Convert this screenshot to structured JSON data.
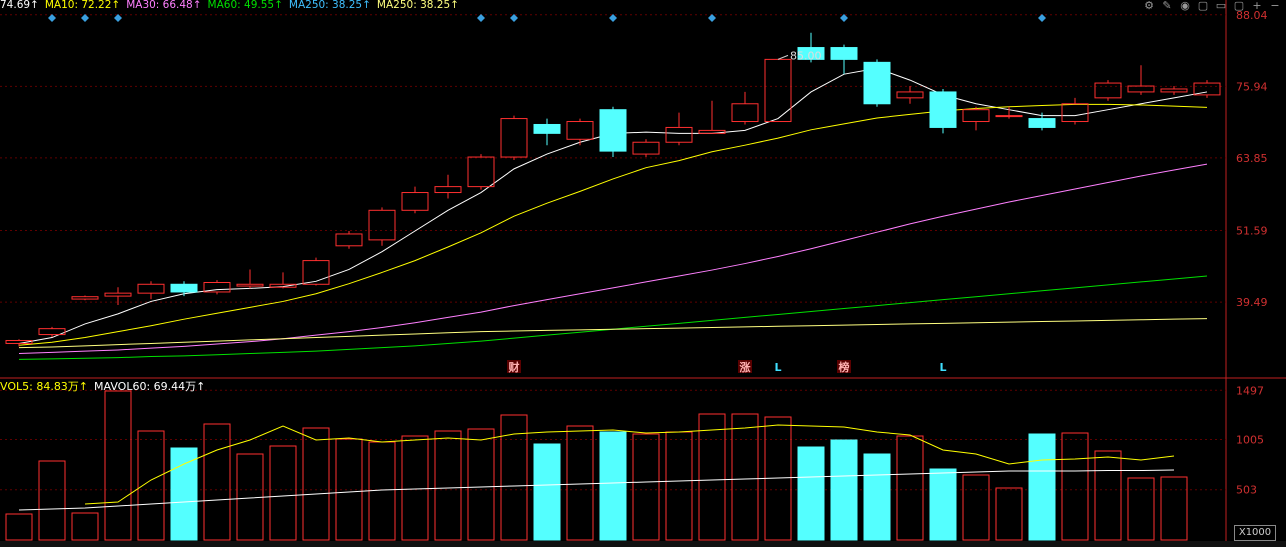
{
  "header": {
    "ma5": {
      "label": "74.69",
      "color": "#ffffff"
    },
    "ma10": {
      "label": "MA10: 72.22",
      "color": "#ffff00"
    },
    "ma30": {
      "label": "MA30: 66.48",
      "color": "#ff80ff"
    },
    "ma60": {
      "label": "MA60: 49.55",
      "color": "#00e000"
    },
    "ma250a": {
      "label": "MA250: 38.25",
      "color": "#40c0ff"
    },
    "ma250b": {
      "label": "MA250: 38.25",
      "color": "#ffff80"
    },
    "arrow": "↑"
  },
  "volume_header": {
    "mavol5": {
      "label": "VOL5: 84.83万",
      "color": "#ffff00"
    },
    "mavol60": {
      "label": "MAVOL60: 69.44万",
      "color": "#ffffff"
    },
    "arrow": "↑"
  },
  "tools": [
    "⚙",
    "✎",
    "◉",
    "▢",
    "▭",
    "▢",
    "+",
    "−"
  ],
  "volume_unit": "X1000",
  "colors": {
    "background": "#000000",
    "up": "#ff3030",
    "down": "#54ffff",
    "grid": "#600000",
    "axis": "#c02020",
    "axis_text": "#d03030"
  },
  "chart_data": [
    {
      "type": "candlestick",
      "y_ticks": [
        "88.04",
        "75.94",
        "63.85",
        "51.59",
        "39.49"
      ],
      "y_tick_values": [
        88.04,
        75.94,
        63.85,
        51.59,
        39.49
      ],
      "ylim": [
        27.0,
        88.0
      ],
      "grid": true,
      "annotation_high": {
        "label": "85.00",
        "index": 23
      },
      "candles": [
        {
          "o": 32.5,
          "c": 33.0,
          "h": 33.2,
          "l": 32.0
        },
        {
          "o": 34.0,
          "c": 35.0,
          "h": 35.3,
          "l": 33.6
        },
        {
          "o": 40.0,
          "c": 40.4,
          "h": 40.6,
          "l": 39.8
        },
        {
          "o": 40.5,
          "c": 41.0,
          "h": 42.0,
          "l": 39.0
        },
        {
          "o": 41.0,
          "c": 42.5,
          "h": 43.0,
          "l": 40.0
        },
        {
          "o": 42.5,
          "c": 41.2,
          "h": 43.0,
          "l": 40.5
        },
        {
          "o": 41.2,
          "c": 42.8,
          "h": 43.2,
          "l": 40.8
        },
        {
          "o": 42.2,
          "c": 42.5,
          "h": 45.0,
          "l": 41.8
        },
        {
          "o": 42.0,
          "c": 42.5,
          "h": 44.5,
          "l": 41.8
        },
        {
          "o": 42.5,
          "c": 46.5,
          "h": 47.0,
          "l": 42.3
        },
        {
          "o": 49.0,
          "c": 51.0,
          "h": 51.5,
          "l": 48.5
        },
        {
          "o": 50.0,
          "c": 55.0,
          "h": 55.5,
          "l": 49.0
        },
        {
          "o": 55.0,
          "c": 58.0,
          "h": 59.0,
          "l": 54.5
        },
        {
          "o": 58.0,
          "c": 59.0,
          "h": 61.0,
          "l": 57.0
        },
        {
          "o": 59.0,
          "c": 64.0,
          "h": 64.5,
          "l": 58.5
        },
        {
          "o": 64.0,
          "c": 70.5,
          "h": 71.0,
          "l": 63.5
        },
        {
          "o": 69.5,
          "c": 68.0,
          "h": 70.5,
          "l": 66.0
        },
        {
          "o": 67.0,
          "c": 70.0,
          "h": 70.5,
          "l": 66.0
        },
        {
          "o": 72.0,
          "c": 65.0,
          "h": 72.5,
          "l": 64.0
        },
        {
          "o": 64.5,
          "c": 66.5,
          "h": 67.0,
          "l": 64.0
        },
        {
          "o": 66.5,
          "c": 69.0,
          "h": 71.5,
          "l": 66.0
        },
        {
          "o": 68.0,
          "c": 68.5,
          "h": 73.5,
          "l": 68.0
        },
        {
          "o": 70.0,
          "c": 73.0,
          "h": 75.0,
          "l": 69.5
        },
        {
          "o": 70.0,
          "c": 80.5,
          "h": 80.5,
          "l": 70.0
        },
        {
          "o": 82.5,
          "c": 80.5,
          "h": 85.0,
          "l": 80.0
        },
        {
          "o": 82.5,
          "c": 80.5,
          "h": 83.0,
          "l": 78.0
        },
        {
          "o": 80.0,
          "c": 73.0,
          "h": 80.5,
          "l": 72.5
        },
        {
          "o": 74.0,
          "c": 75.0,
          "h": 76.0,
          "l": 73.0
        },
        {
          "o": 75.0,
          "c": 69.0,
          "h": 75.5,
          "l": 68.0
        },
        {
          "o": 70.0,
          "c": 72.0,
          "h": 72.5,
          "l": 68.5
        },
        {
          "o": 71.0,
          "c": 71.0,
          "h": 72.5,
          "l": 70.5
        },
        {
          "o": 70.5,
          "c": 69.0,
          "h": 71.5,
          "l": 68.5
        },
        {
          "o": 70.0,
          "c": 73.0,
          "h": 74.0,
          "l": 69.5
        },
        {
          "o": 74.0,
          "c": 76.5,
          "h": 77.0,
          "l": 73.5
        },
        {
          "o": 75.0,
          "c": 76.0,
          "h": 79.5,
          "l": 74.5
        },
        {
          "o": 75.0,
          "c": 75.5,
          "h": 76.0,
          "l": 74.5
        },
        {
          "o": 74.5,
          "c": 76.5,
          "h": 77.0,
          "l": 74.0
        }
      ],
      "series": [
        {
          "color_key": "ma5",
          "values": [
            32.5,
            33.5,
            35.8,
            37.5,
            39.6,
            40.9,
            41.6,
            41.8,
            42.1,
            43.0,
            45.0,
            48.0,
            51.5,
            55.0,
            58.0,
            62.0,
            64.5,
            66.5,
            68.0,
            68.2,
            68.0,
            68.0,
            68.5,
            70.5,
            75.0,
            78.0,
            79.0,
            77.0,
            74.5,
            73.0,
            72.0,
            71.0,
            71.0,
            72.0,
            73.0,
            74.0,
            75.0
          ]
        },
        {
          "color_key": "ma10",
          "values": [
            32.2,
            32.7,
            33.5,
            34.5,
            35.5,
            36.6,
            37.6,
            38.6,
            39.6,
            40.9,
            42.6,
            44.5,
            46.5,
            48.8,
            51.2,
            54.0,
            56.2,
            58.2,
            60.3,
            62.2,
            63.4,
            64.9,
            66.0,
            67.2,
            68.6,
            69.6,
            70.6,
            71.2,
            71.8,
            72.2,
            72.5,
            72.7,
            72.9,
            72.9,
            72.8,
            72.6,
            72.4
          ]
        },
        {
          "color_key": "ma30",
          "values": [
            30.8,
            31.0,
            31.2,
            31.4,
            31.7,
            32.0,
            32.4,
            32.8,
            33.3,
            33.9,
            34.5,
            35.2,
            36.0,
            36.9,
            37.8,
            38.9,
            39.9,
            40.9,
            41.9,
            42.9,
            43.9,
            44.9,
            46.0,
            47.2,
            48.5,
            49.9,
            51.3,
            52.7,
            54.0,
            55.2,
            56.4,
            57.5,
            58.6,
            59.7,
            60.8,
            61.8,
            62.8
          ]
        },
        {
          "color_key": "ma60",
          "values": [
            29.8,
            29.9,
            30.0,
            30.1,
            30.3,
            30.4,
            30.6,
            30.8,
            31.0,
            31.2,
            31.5,
            31.8,
            32.1,
            32.5,
            32.9,
            33.4,
            33.9,
            34.4,
            34.9,
            35.4,
            35.9,
            36.4,
            36.9,
            37.4,
            37.9,
            38.4,
            38.9,
            39.4,
            39.9,
            40.4,
            40.9,
            41.4,
            41.9,
            42.4,
            42.9,
            43.4,
            43.9
          ]
        },
        {
          "color_key": "ma250b",
          "values": [
            31.8,
            31.9,
            32.1,
            32.3,
            32.5,
            32.7,
            32.9,
            33.1,
            33.3,
            33.5,
            33.7,
            33.9,
            34.1,
            34.3,
            34.5,
            34.6,
            34.7,
            34.8,
            34.9,
            35.0,
            35.1,
            35.2,
            35.3,
            35.4,
            35.5,
            35.6,
            35.7,
            35.8,
            35.9,
            36.0,
            36.1,
            36.2,
            36.3,
            36.4,
            36.5,
            36.6,
            36.7
          ]
        }
      ],
      "markers_top": [
        1,
        2,
        3,
        14,
        15,
        18,
        21,
        25,
        31
      ],
      "event_labels": [
        {
          "index": 15,
          "label": "财",
          "boxed": true
        },
        {
          "index": 22,
          "label": "涨",
          "boxed": true
        },
        {
          "index": 23,
          "label": "L",
          "boxed": false
        },
        {
          "index": 25,
          "label": "榜",
          "boxed": true
        },
        {
          "index": 28,
          "label": "L",
          "boxed": false
        }
      ]
    },
    {
      "type": "bar",
      "y_ticks": [
        "1497",
        "1005",
        "503"
      ],
      "y_tick_values": [
        1497,
        1005,
        503
      ],
      "ylim": [
        0,
        1560
      ],
      "volumes": [
        260,
        790,
        270,
        1490,
        1090,
        920,
        1160,
        860,
        940,
        1120,
        1010,
        980,
        1040,
        1090,
        1110,
        1250,
        960,
        1140,
        1080,
        1060,
        1080,
        1260,
        1260,
        1230,
        930,
        1000,
        860,
        1040,
        710,
        650,
        520,
        1060,
        1070,
        890,
        620,
        630
      ],
      "mavol5": [
        null,
        null,
        360,
        380,
        600,
        760,
        900,
        1000,
        1140,
        1000,
        1020,
        980,
        1000,
        1020,
        1000,
        1060,
        1080,
        1090,
        1100,
        1070,
        1080,
        1100,
        1120,
        1150,
        1140,
        1130,
        1080,
        1050,
        900,
        860,
        760,
        800,
        810,
        830,
        800,
        840
      ],
      "mavol60": [
        300,
        310,
        320,
        340,
        360,
        380,
        400,
        420,
        440,
        460,
        480,
        500,
        510,
        520,
        530,
        540,
        550,
        560,
        570,
        580,
        590,
        600,
        610,
        620,
        630,
        640,
        650,
        660,
        670,
        680,
        690,
        690,
        690,
        695,
        695,
        700
      ]
    }
  ]
}
